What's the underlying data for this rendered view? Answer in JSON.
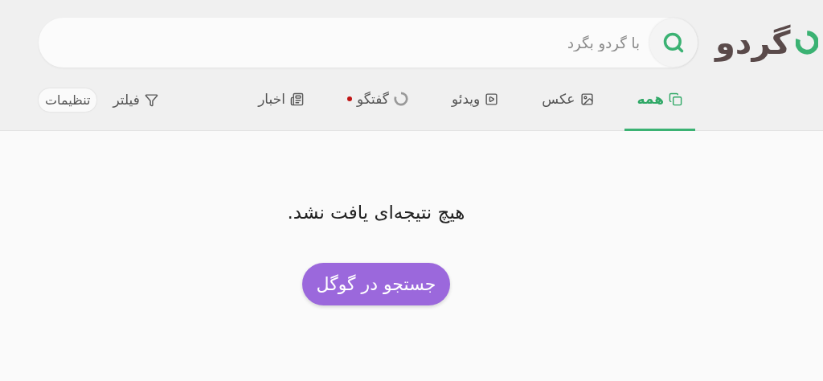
{
  "logo": {
    "text": "گردو"
  },
  "search": {
    "placeholder": "با گردو بگرد"
  },
  "tabs": [
    {
      "label": "همه",
      "selected": true,
      "badge": false
    },
    {
      "label": "عکس",
      "selected": false,
      "badge": false
    },
    {
      "label": "ویدئو",
      "selected": false,
      "badge": false
    },
    {
      "label": "گفتگو",
      "selected": false,
      "badge": true
    },
    {
      "label": "اخبار",
      "selected": false,
      "badge": false
    }
  ],
  "filter": {
    "label": "فیلتر"
  },
  "settings": {
    "label": "تنظیمات"
  },
  "message": "هیچ نتیجه‌ای یافت نشد.",
  "google_button": {
    "label": "جستجو در گوگل"
  }
}
